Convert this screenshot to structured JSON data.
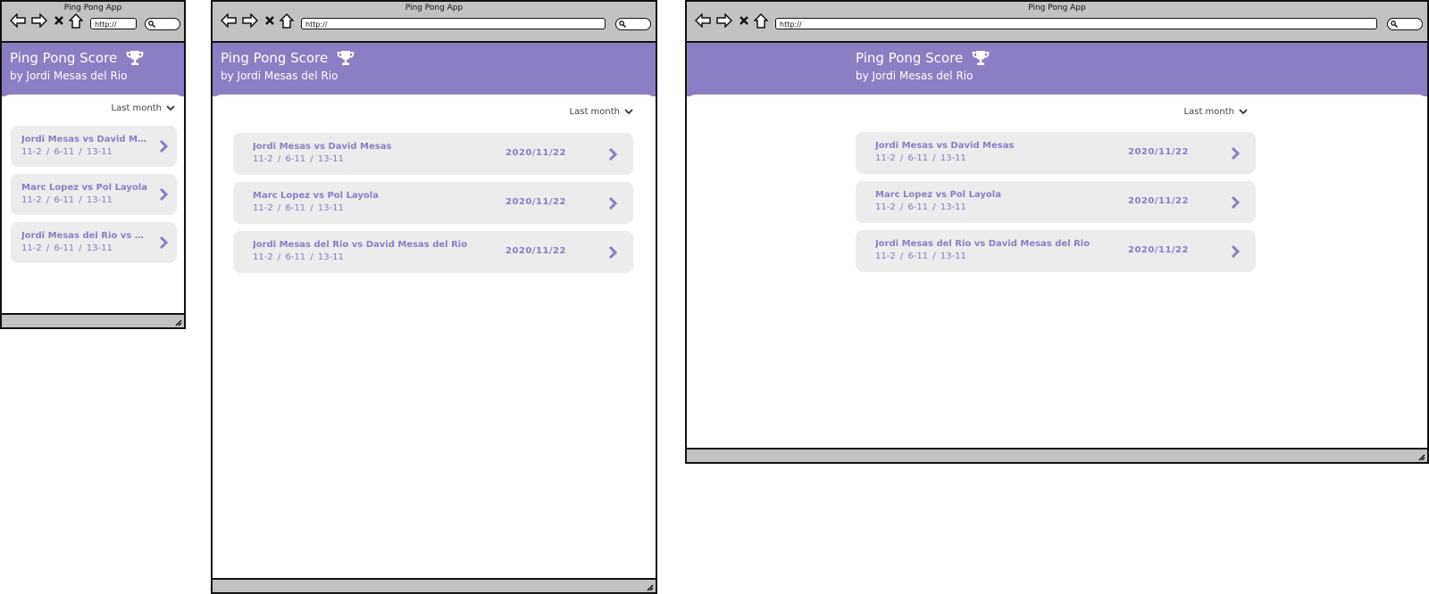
{
  "window_title": "Ping Pong App",
  "url": "http://",
  "app": {
    "title": "Ping Pong Score",
    "subtitle": "by Jordi Mesas del Rio",
    "title_icon": "trophy-icon"
  },
  "filter": {
    "label": "Last month",
    "icon": "chevron-down-icon"
  },
  "matches_mobile": [
    {
      "players": "Jordi Mesas vs David Mesas",
      "scores": "11-2  /  6-11  /  13-11"
    },
    {
      "players": "Marc Lopez vs Pol Layola",
      "scores": "11-2  /  6-11  /  13-11"
    },
    {
      "players": "Jordi Mesas del Rio vs David Mesas del Rio",
      "scores": "11-2  /  6-11  /  13-11"
    }
  ],
  "matches": [
    {
      "players": "Jordi Mesas vs David Mesas",
      "scores": "11-2  /  6-11  /  13-11",
      "date": "2020/11/22"
    },
    {
      "players": "Marc Lopez vs Pol Layola",
      "scores": "11-2  /  6-11  /  13-11",
      "date": "2020/11/22"
    },
    {
      "players": "Jordi Mesas del Rio vs David Mesas del Rio",
      "scores": "11-2  /  6-11  /  13-11",
      "date": "2020/11/22"
    }
  ],
  "colors": {
    "accent": "#8c7ec4",
    "card": "#ececec",
    "chrome": "#c2c2c2"
  }
}
